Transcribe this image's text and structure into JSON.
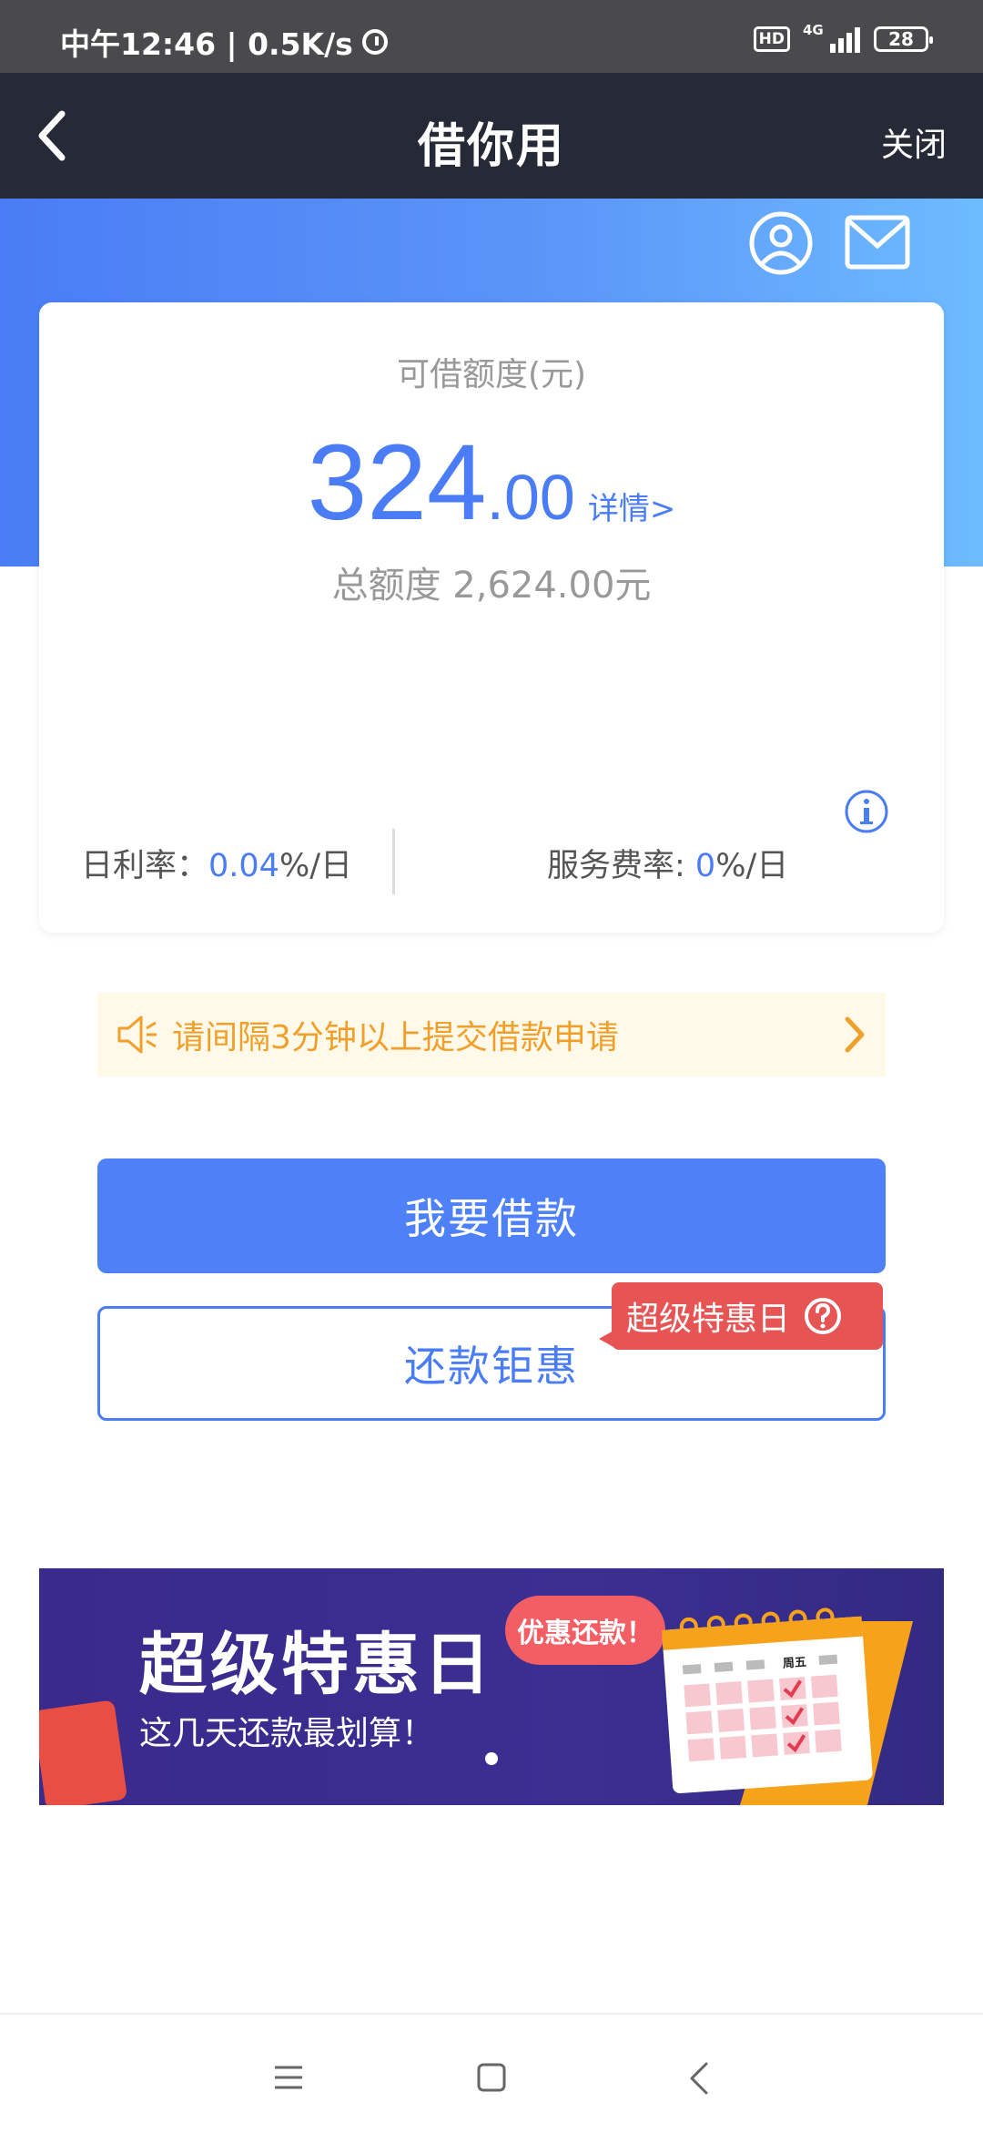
{
  "status_bar": {
    "time_speed": "中午12:46 | 0.5K/s",
    "hd": "HD",
    "network": "4G",
    "battery": "28"
  },
  "header": {
    "title": "借你用",
    "close_label": "关闭"
  },
  "credit": {
    "label": "可借额度(元)",
    "amount_integer": "324",
    "amount_decimal": ".00",
    "detail_link": "详情>",
    "total_label": "总额度 2,624.00元",
    "daily_rate_label": "日利率：",
    "daily_rate_value": "0.04",
    "daily_rate_unit": "%/日",
    "service_rate_label": "服务费率: ",
    "service_rate_value": "0",
    "service_rate_unit": "%/日"
  },
  "notice": {
    "text": "请间隔3分钟以上提交借款申请"
  },
  "actions": {
    "borrow_label": "我要借款",
    "repay_label": "还款钜惠",
    "promo_tag": "超级特惠日"
  },
  "banner": {
    "title": "超级特惠日",
    "subtitle": "这几天还款最划算！",
    "bubble": "优惠还款！",
    "calendar_day": "周五"
  },
  "colors": {
    "accent": "#4a7df5",
    "nav_bg": "#262a37",
    "promo_red": "#e65454",
    "notice_orange": "#f0a02a"
  }
}
